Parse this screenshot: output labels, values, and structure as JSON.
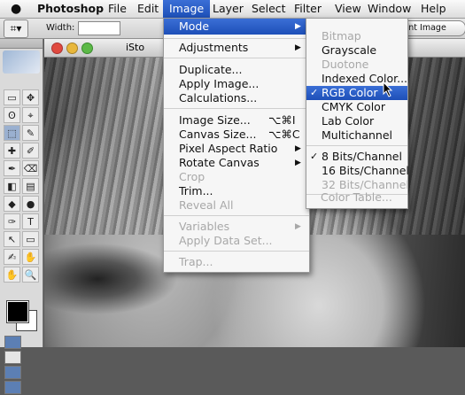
{
  "menubar": {
    "apple": "",
    "items": [
      "Photoshop",
      "File",
      "Edit",
      "Image",
      "Layer",
      "Select",
      "Filter",
      "View",
      "Window",
      "Help"
    ]
  },
  "options": {
    "width_label": "Width:",
    "front_image": "Front Image"
  },
  "document": {
    "title": "iSto"
  },
  "image_menu": {
    "mode": "Mode",
    "adjustments": "Adjustments",
    "duplicate": "Duplicate...",
    "apply_image": "Apply Image...",
    "calculations": "Calculations...",
    "image_size": "Image Size...",
    "image_size_sc": "⌥⌘I",
    "canvas_size": "Canvas Size...",
    "canvas_size_sc": "⌥⌘C",
    "pixel_aspect": "Pixel Aspect Ratio",
    "rotate_canvas": "Rotate Canvas",
    "crop": "Crop",
    "trim": "Trim...",
    "reveal_all": "Reveal All",
    "variables": "Variables",
    "apply_data_set": "Apply Data Set...",
    "trap": "Trap..."
  },
  "mode_menu": {
    "bitmap": "Bitmap",
    "grayscale": "Grayscale",
    "duotone": "Duotone",
    "indexed": "Indexed Color...",
    "rgb": "RGB Color",
    "cmyk": "CMYK Color",
    "lab": "Lab Color",
    "multichannel": "Multichannel",
    "bits8": "8 Bits/Channel",
    "bits16": "16 Bits/Channel",
    "bits32": "32 Bits/Channel",
    "color_table": "Color Table..."
  },
  "toolbox": {
    "tools": [
      "▭",
      "✥",
      "ʘ",
      "⌖",
      "⬚",
      "✎",
      "✚",
      "✐",
      "✒",
      "⌫",
      "◧",
      "▤",
      "◆",
      "●",
      "✑",
      "T",
      "↖",
      "▭",
      "✍",
      "✋",
      "✋",
      "🔍"
    ]
  }
}
